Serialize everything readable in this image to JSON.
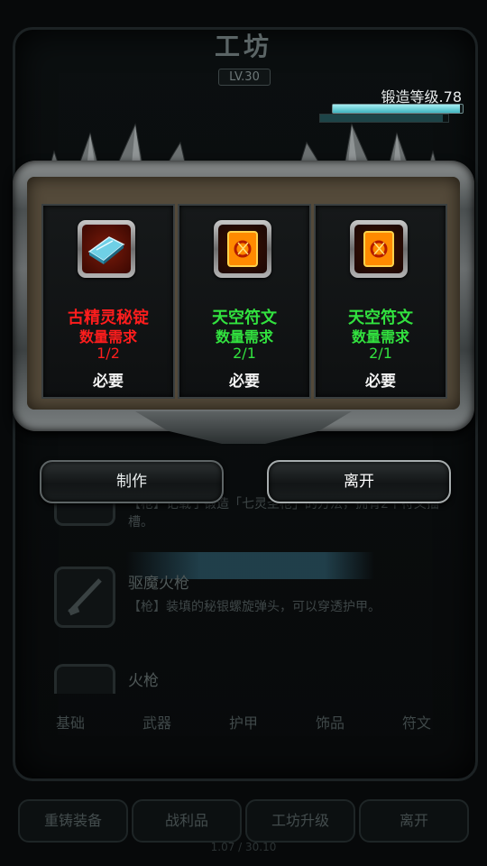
{
  "background": {
    "title": "工坊",
    "level_badge": "LV.30",
    "items": [
      {
        "name": "",
        "desc": "【枪】记载了锻造「七灵圣枪」的方法，拥有2个符文插槽。"
      },
      {
        "name": "驱魔火枪",
        "desc": "【枪】装填的秘银螺旋弹头，可以穿透护甲。"
      },
      {
        "name": "火枪",
        "desc": ""
      }
    ],
    "tabs": [
      "基础",
      "武器",
      "护甲",
      "饰品",
      "符文"
    ],
    "bottom_buttons": [
      "重铸装备",
      "战利品",
      "工坊升级",
      "离开"
    ],
    "footer": "1.07 / 30.10"
  },
  "forge": {
    "level_label": "锻造等级.78",
    "progress": 0.98,
    "secondary_progress": 0.96
  },
  "materials": [
    {
      "name": "古精灵秘锭",
      "req_label": "数量需求",
      "count": "1/2",
      "required": "必要",
      "status": "insufficient",
      "icon": "mithril-ingot-icon"
    },
    {
      "name": "天空符文",
      "req_label": "数量需求",
      "count": "2/1",
      "required": "必要",
      "status": "sufficient",
      "icon": "sky-rune-icon"
    },
    {
      "name": "天空符文",
      "req_label": "数量需求",
      "count": "2/1",
      "required": "必要",
      "status": "sufficient",
      "icon": "sky-rune-icon"
    }
  ],
  "actions": {
    "craft_label": "制作",
    "leave_label": "离开"
  },
  "colors": {
    "insufficient": "#ff1d1d",
    "sufficient": "#32e23f",
    "panel_wood": "#544a3a"
  }
}
